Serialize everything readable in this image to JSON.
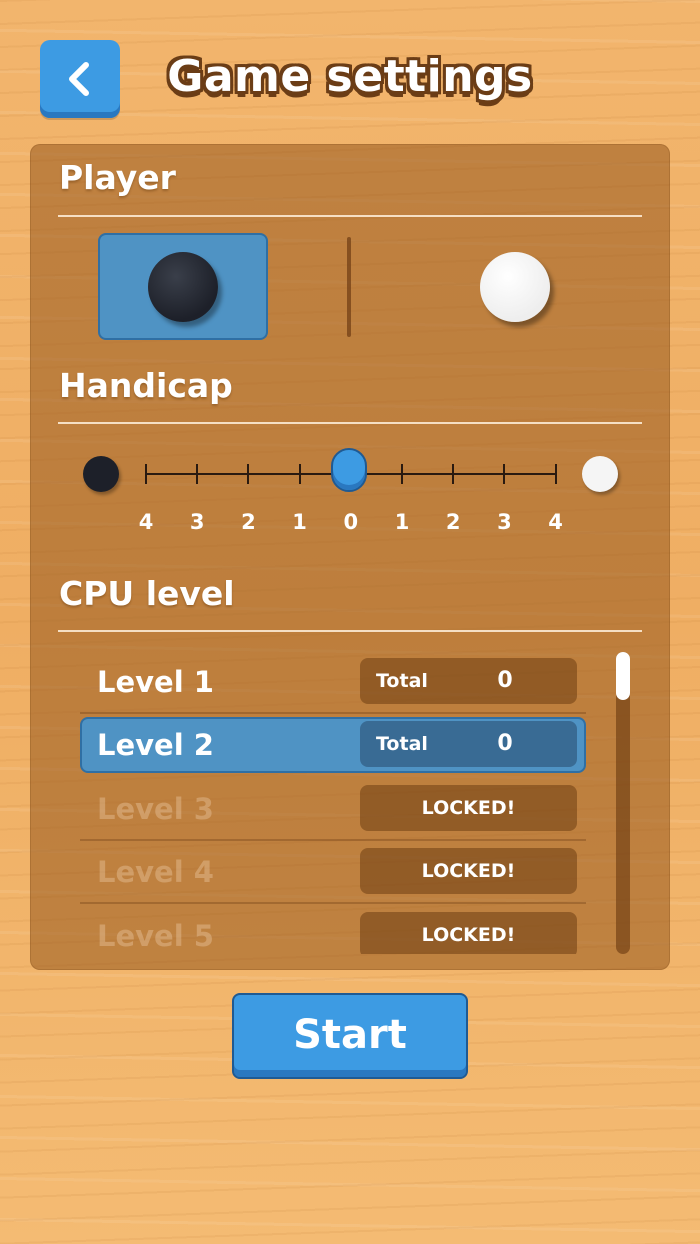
{
  "header": {
    "title": "Game settings",
    "back_icon": "chevron-left-icon"
  },
  "player": {
    "label": "Player",
    "options": [
      {
        "name": "black",
        "selected": true
      },
      {
        "name": "white",
        "selected": false
      }
    ]
  },
  "handicap": {
    "label": "Handicap",
    "scale": [
      "4",
      "3",
      "2",
      "1",
      "0",
      "1",
      "2",
      "3",
      "4"
    ],
    "value": "0"
  },
  "cpu": {
    "label": "CPU level",
    "levels": [
      {
        "name": "Level 1",
        "stat_label": "Total",
        "stat_value": "0",
        "locked": false,
        "selected": false
      },
      {
        "name": "Level 2",
        "stat_label": "Total",
        "stat_value": "0",
        "locked": false,
        "selected": true
      },
      {
        "name": "Level 3",
        "locked_text": "LOCKED!",
        "locked": true
      },
      {
        "name": "Level 4",
        "locked_text": "LOCKED!",
        "locked": true
      },
      {
        "name": "Level 5",
        "locked_text": "LOCKED!",
        "locked": true
      }
    ]
  },
  "start_label": "Start",
  "colors": {
    "accent": "#3d9be3",
    "selected": "#4f93c4",
    "panel": "#96581e",
    "outline": "#6b3d16"
  }
}
